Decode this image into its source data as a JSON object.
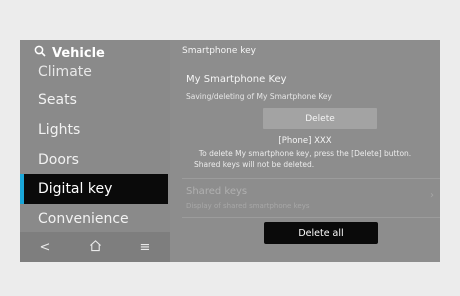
{
  "sidebar": {
    "title": "Vehicle",
    "items": [
      {
        "label": "Climate"
      },
      {
        "label": "Seats"
      },
      {
        "label": "Lights"
      },
      {
        "label": "Doors"
      },
      {
        "label": "Digital key"
      },
      {
        "label": "Convenience"
      }
    ],
    "bottom": {
      "back": "<",
      "home_icon": "home-icon",
      "menu": "≡"
    }
  },
  "content": {
    "title": "Smartphone key",
    "my_key": {
      "title": "My Smartphone Key",
      "subtitle": "Saving/deleting of My Smartphone Key",
      "delete_label": "Delete",
      "phone_label": "[Phone] XXX",
      "note_line1": "To delete My smartphone key, press the [Delete] button.",
      "note_line2": "Shared keys will not be deleted."
    },
    "shared": {
      "title": "Shared keys",
      "subtitle": "Display of shared smartphone keys",
      "chevron": "›"
    },
    "delete_all_label": "Delete all"
  },
  "colors": {
    "accent": "#1aa6d8",
    "screen_bg": "#8d8d8d",
    "active_bg": "#0a0a0a"
  }
}
